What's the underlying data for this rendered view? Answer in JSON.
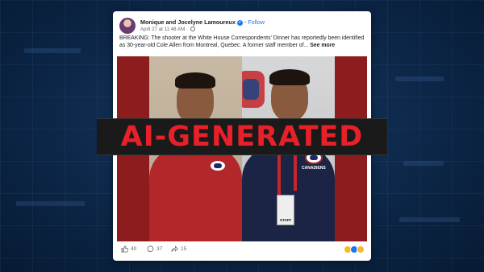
{
  "post": {
    "author": "Monique and Jocelyne Lamoureux",
    "follow_label": "Follow",
    "timestamp": "April 27 at 11:48 AM ·",
    "text": "BREAKING: The shooter at the White House Correspondents' Dinner has reportedly been identified as 30-year-old Cole Allen from Montreal, Quebec. A former staff member of...",
    "see_more": "See more",
    "image_right_shirt_text": "CANADIENS",
    "badge_text": "STAFF",
    "stats": {
      "likes": "40",
      "comments": "37",
      "shares": "15"
    }
  },
  "overlay": {
    "label": "AI-GENERATED",
    "color": "#e8202a"
  },
  "colors": {
    "background": "#0c2748",
    "facebook_blue": "#1877f2",
    "jersey_red": "#b3262a",
    "jersey_navy": "#1b2444"
  },
  "icons": [
    "like-icon",
    "comment-icon",
    "share-icon",
    "verified-icon",
    "globe-icon"
  ]
}
